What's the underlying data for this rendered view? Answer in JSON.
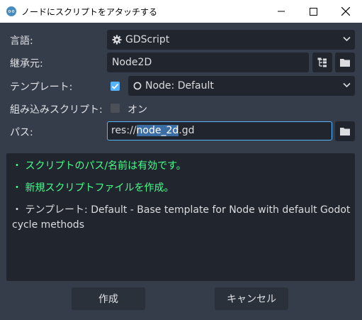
{
  "window": {
    "title": "ノードにスクリプトをアタッチする"
  },
  "form": {
    "language": {
      "label": "言語:",
      "value": "GDScript"
    },
    "inherits": {
      "label": "継承元:",
      "value": "Node2D"
    },
    "template": {
      "label": "テンプレート:",
      "value": "Node: Default",
      "checked": true
    },
    "builtin": {
      "label": "組み込みスクリプト:",
      "option": "オン",
      "checked": false
    },
    "path": {
      "label": "パス:",
      "prefix": "res://",
      "selected": "node_2d",
      "suffix": ".gd"
    }
  },
  "messages": {
    "valid": "・ スクリプトのパス/名前は有効です。",
    "create": "・ 新規スクリプトファイルを作成。",
    "template_line1": "・ テンプレート: Default - Base template for Node with default Godot",
    "template_line2": "cycle methods"
  },
  "buttons": {
    "create": "作成",
    "cancel": "キャンセル"
  },
  "colors": {
    "background": "#363d4a",
    "field": "#21262e",
    "accent": "#57b3ff",
    "valid_text": "#45ff8b"
  }
}
